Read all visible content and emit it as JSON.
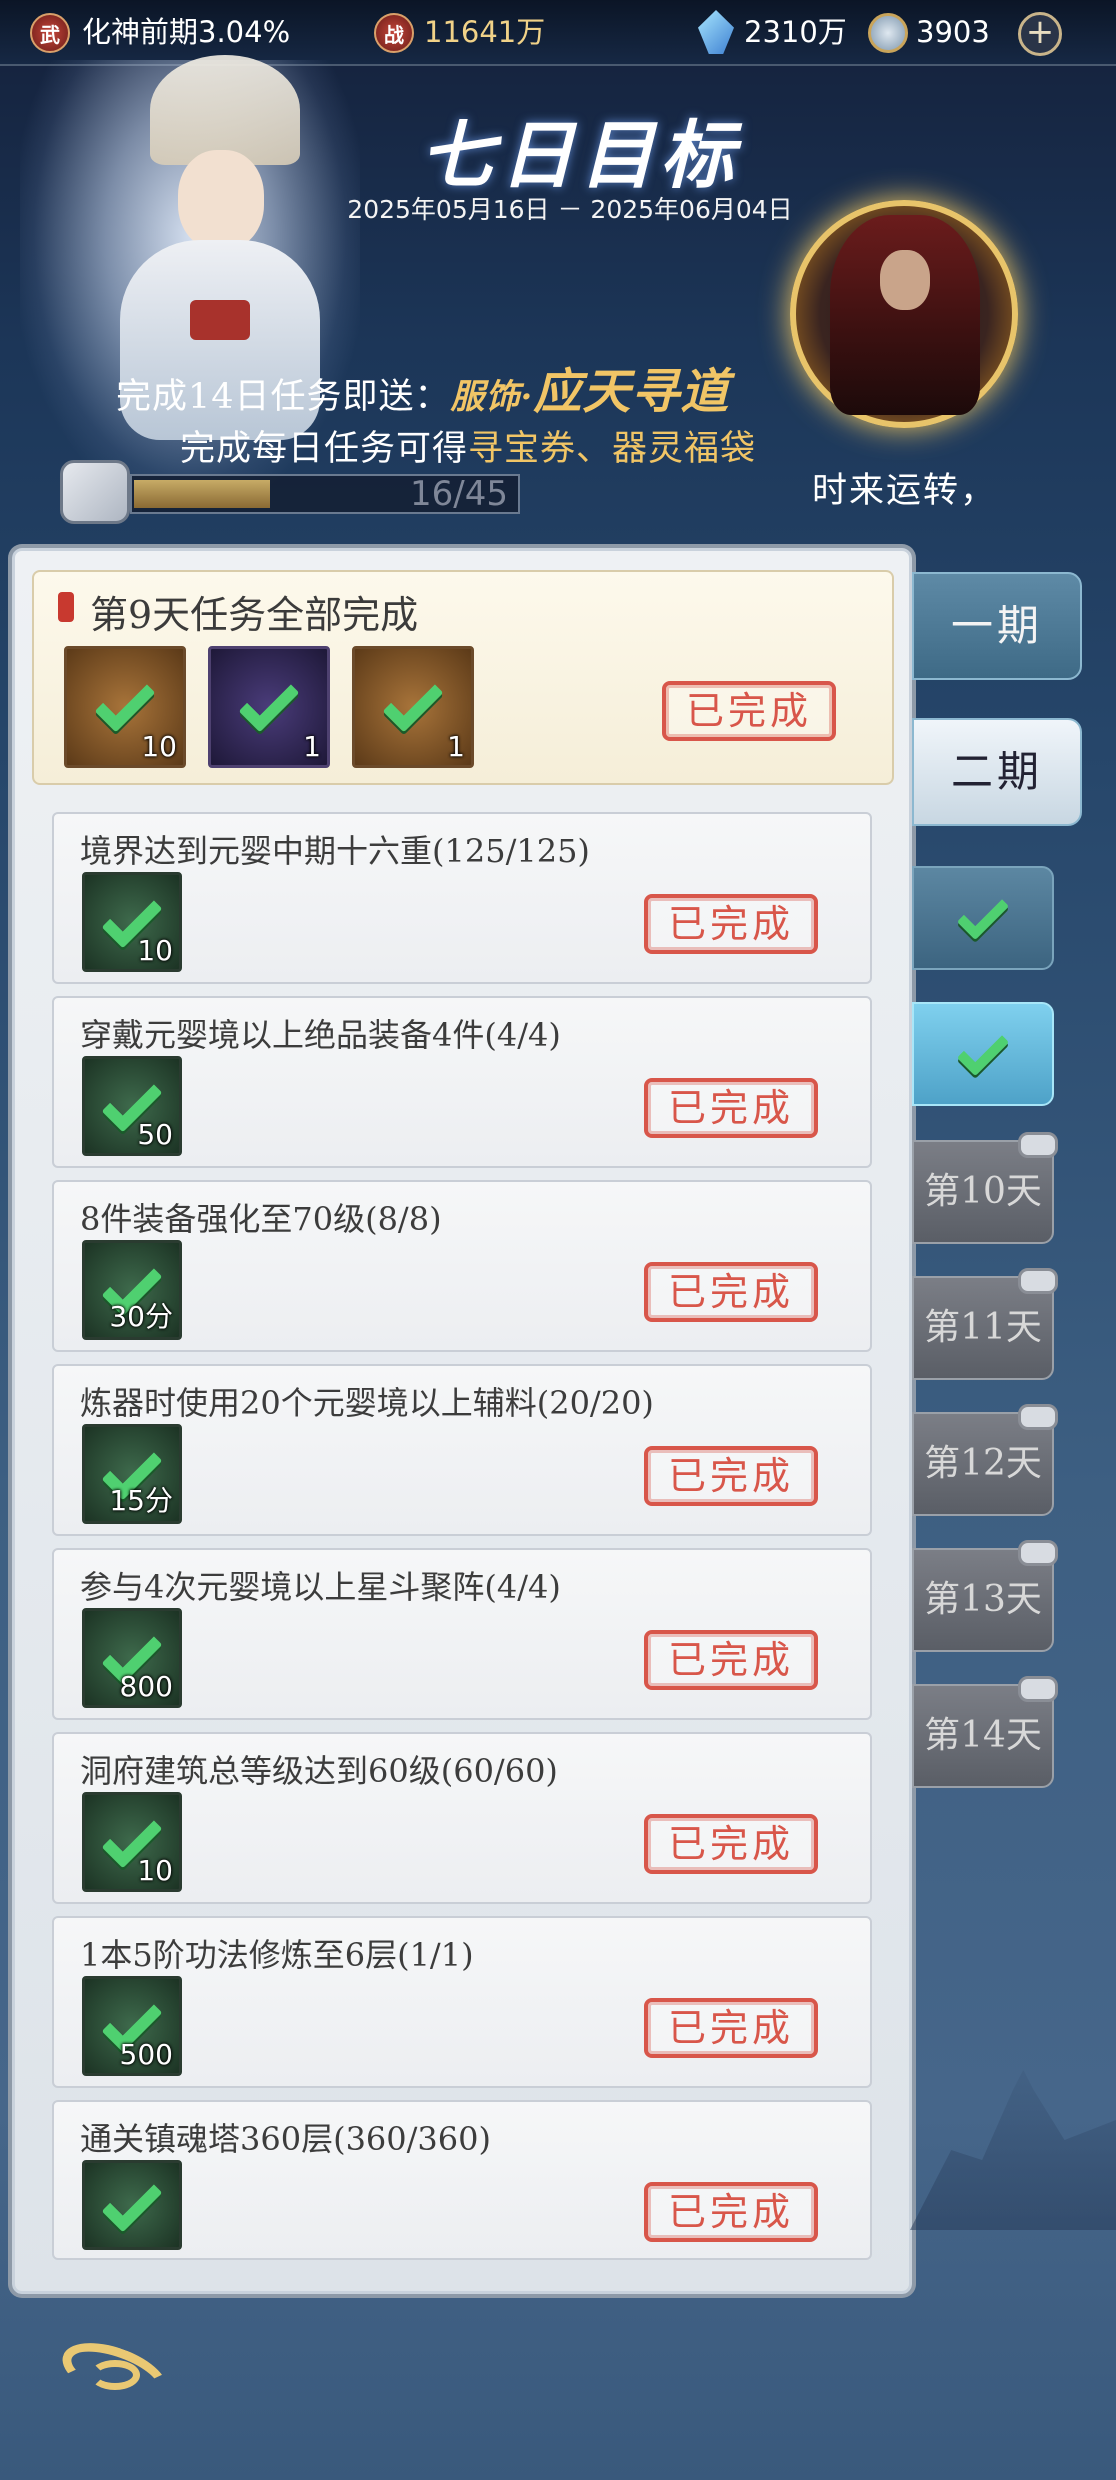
{
  "topbar": {
    "rank_icon_text": "武",
    "rank_label": "化神前期3.04%",
    "power_icon_text": "战",
    "power_value": "11641万",
    "gems": "2310万",
    "coins": "3903",
    "add_label": "+"
  },
  "header": {
    "title": "七日目标",
    "date_range": "2025年05月16日 － 2025年06月04日",
    "reward_prefix": "完成14日任务即送：",
    "reward_type": "服饰·",
    "reward_name": "应天寻道",
    "daily_text_prefix": "完成每日任务可得",
    "daily_rewards": "寻宝券、器灵福袋",
    "progress_text": "16/45",
    "progress_fraction": 0.356,
    "slogan": "时来运转，"
  },
  "day_summary": {
    "title": "第9天任务全部完成",
    "items": [
      {
        "icon": "purple-banner-item",
        "qty": "10",
        "style": "brown"
      },
      {
        "icon": "spirit-orb-item",
        "qty": "1",
        "style": "purple"
      },
      {
        "icon": "treasure-chest-item",
        "qty": "1",
        "style": "brown"
      }
    ],
    "status": "已完成"
  },
  "tasks": [
    {
      "title": "境界达到元婴中期十六重(125/125)",
      "qty": "10",
      "status": "已完成"
    },
    {
      "title": "穿戴元婴境以上绝品装备4件(4/4)",
      "qty": "50",
      "status": "已完成"
    },
    {
      "title": "8件装备强化至70级(8/8)",
      "qty": "30分",
      "status": "已完成"
    },
    {
      "title": "炼器时使用20个元婴境以上辅料(20/20)",
      "qty": "15分",
      "status": "已完成"
    },
    {
      "title": "参与4次元婴境以上星斗聚阵(4/4)",
      "qty": "800",
      "status": "已完成"
    },
    {
      "title": "洞府建筑总等级达到60级(60/60)",
      "qty": "10",
      "status": "已完成"
    },
    {
      "title": "1本5阶功法修炼至6层(1/1)",
      "qty": "500",
      "status": "已完成"
    },
    {
      "title": "通关镇魂塔360层(360/360)",
      "qty": "",
      "status": "已完成"
    }
  ],
  "phase_tabs": [
    {
      "label": "一期",
      "selected": false
    },
    {
      "label": "二期",
      "selected": true
    }
  ],
  "day_tabs": [
    {
      "label": "",
      "state": "done"
    },
    {
      "label": "",
      "state": "active"
    },
    {
      "label": "第10天",
      "state": "locked"
    },
    {
      "label": "第11天",
      "state": "locked"
    },
    {
      "label": "第12天",
      "state": "locked"
    },
    {
      "label": "第13天",
      "state": "locked"
    },
    {
      "label": "第14天",
      "state": "locked"
    }
  ],
  "colors": {
    "accent_gold": "#f1c566",
    "done_red": "#d8564a",
    "check_green": "#4fd070"
  }
}
